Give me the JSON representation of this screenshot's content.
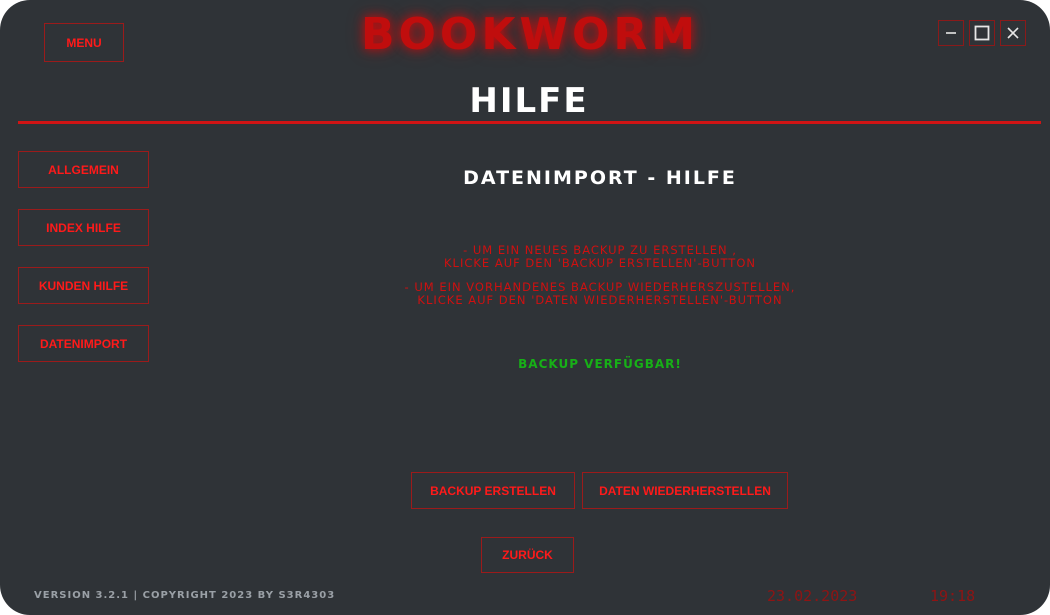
{
  "app": {
    "logo_text": "BOOKWORM",
    "accent_color": "#d11414",
    "background_color": "#2f3337"
  },
  "header": {
    "menu_label": "MENU",
    "page_title": "HILFE",
    "window_controls": {
      "minimize_icon": "minimize-icon",
      "maximize_icon": "maximize-icon",
      "close_icon": "close-icon"
    }
  },
  "sidebar": {
    "items": [
      {
        "label": "ALLGEMEIN"
      },
      {
        "label": "INDEX HILFE"
      },
      {
        "label": "KUNDEN HILFE"
      },
      {
        "label": "DATENIMPORT"
      }
    ]
  },
  "main": {
    "section_title": "DATENIMPORT - HILFE",
    "instructions": [
      {
        "line1": "- UM EIN NEUES BACKUP ZU ERSTELLEN ,",
        "line2": "KLICKE AUF DEN 'BACKUP ERSTELLEN'-BUTTON"
      },
      {
        "line1": "- UM EIN VORHANDENES BACKUP WIEDERHERSZUSTELLEN,",
        "line2": "KLICKE AUF DEN 'DATEN WIEDERHERSTELLEN'-BUTTON"
      }
    ],
    "status_text": "BACKUP VERFÜGBAR!",
    "status_color": "#17b017",
    "backup_button": "BACKUP ERSTELLEN",
    "restore_button": "DATEN WIEDERHERSTELLEN",
    "back_button": "ZURÜCK"
  },
  "footer": {
    "version_text": "VERSION 3.2.1 | COPYRIGHT 2023 BY S3R4303",
    "date": "23.02.2023",
    "time": "19:18"
  }
}
